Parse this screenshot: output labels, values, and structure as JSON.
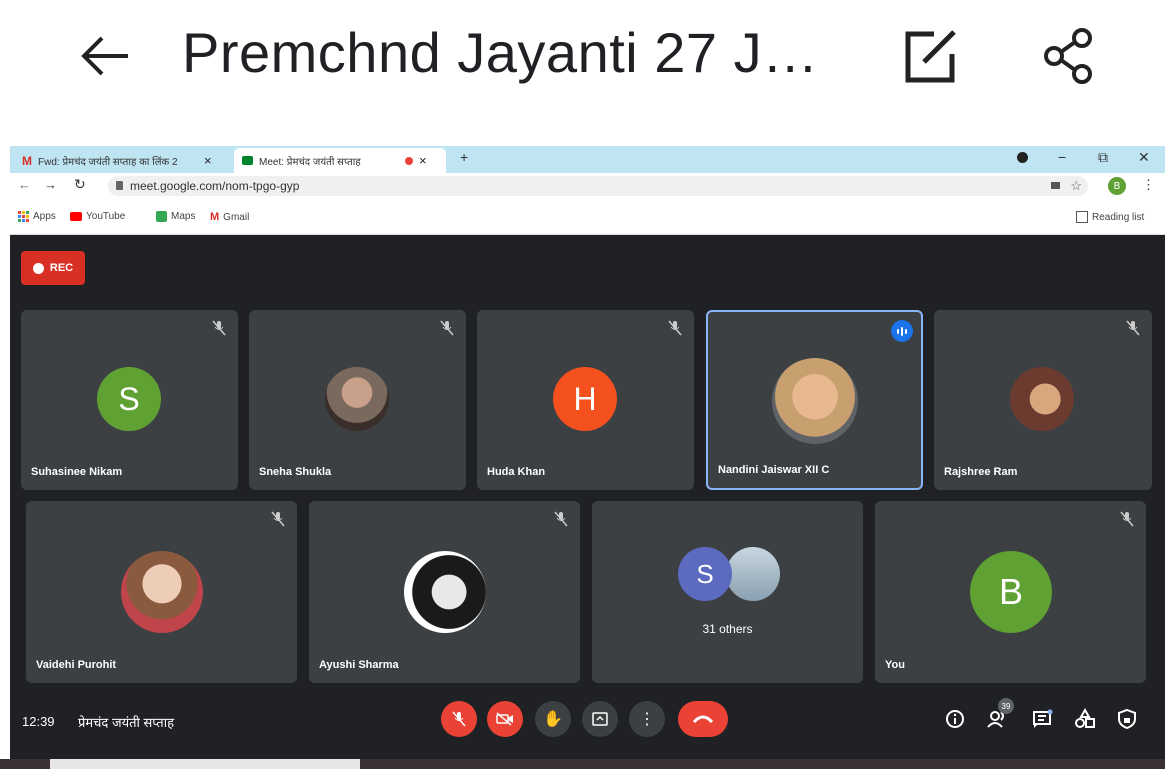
{
  "phone": {
    "title": "Premchnd Jayanti 27 J…",
    "icons": [
      "back-arrow-icon",
      "edit-icon",
      "share-icon"
    ]
  },
  "browser": {
    "tabs": [
      {
        "label": "Fwd: प्रेमचंद जयंती सप्ताह का लिंक 2",
        "close": "×"
      },
      {
        "label": "Meet: प्रेमचंद जयंती सप्ताह",
        "close": "×"
      }
    ],
    "new_tab": "+",
    "url": "meet.google.com/nom-tpgo-gyp",
    "profile_initial": "B",
    "bookmarks": [
      "Apps",
      "YouTube",
      "Maps",
      "Gmail"
    ],
    "reading_list": "Reading list"
  },
  "meet": {
    "rec_label": "REC",
    "participants": [
      {
        "name": "Suhasinee Nikam",
        "initial": "S",
        "color": "#5fa133",
        "muted": true
      },
      {
        "name": "Sneha Shukla",
        "initial": "",
        "color": "#7a6a5e",
        "muted": true
      },
      {
        "name": "Huda Khan",
        "initial": "H",
        "color": "#f4511e",
        "muted": true
      },
      {
        "name": "Nandini Jaiswar XII C",
        "initial": "",
        "color": "#c8a070",
        "muted": false,
        "speaking": true
      },
      {
        "name": "Rajshree Ram",
        "initial": "",
        "color": "#6b3b30",
        "muted": true
      },
      {
        "name": "Vaidehi Purohit",
        "initial": "",
        "color": "#c0454a",
        "muted": true
      },
      {
        "name": "Ayushi Sharma",
        "initial": "",
        "color": "#1a1a1a",
        "muted": true
      },
      {
        "name": "31 others",
        "initial": "S",
        "color": "#5c6bc0",
        "muted": false
      },
      {
        "name": "You",
        "initial": "B",
        "color": "#5fa133",
        "muted": true
      }
    ],
    "time": "12:39",
    "meeting_name": "प्रेमचंद जयंती सप्ताह",
    "people_count": "39",
    "colors": {
      "bg": "#202124",
      "tile": "#3c4043",
      "red": "#ea4335",
      "speaking_border": "#8ab4f8"
    }
  }
}
